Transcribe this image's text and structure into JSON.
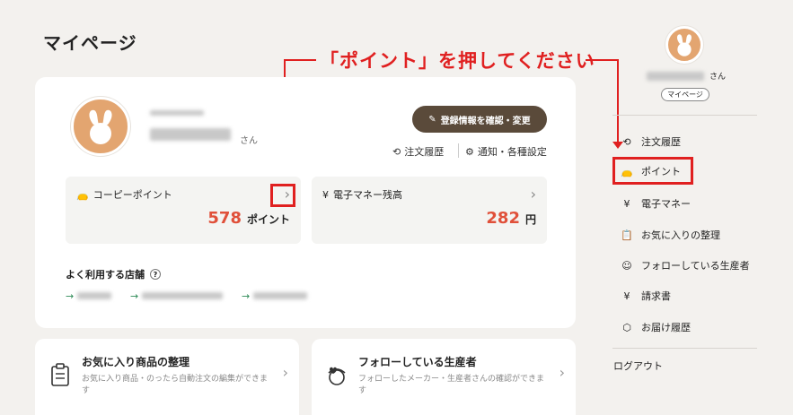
{
  "page": {
    "title": "マイページ"
  },
  "callout": {
    "text": "「ポイント」を押してください"
  },
  "profile": {
    "honorific": "さん",
    "edit_button": "登録情報を確認・変更",
    "order_history": "注文履歴",
    "notification_settings": "通知・各種設定"
  },
  "points": {
    "copy_label": "コーピーポイント",
    "copy_value": "578",
    "copy_unit": "ポイント",
    "emoney_label": "電子マネー残高",
    "emoney_value": "282",
    "emoney_unit": "円"
  },
  "favorites": {
    "title": "よく利用する店舗"
  },
  "cards": [
    {
      "title": "お気に入り商品の整理",
      "sub": "お気に入り商品・のったら自動注文の編集ができます"
    },
    {
      "title": "フォローしている生産者",
      "sub": "フォローしたメーカー・生産者さんの確認ができます"
    }
  ],
  "sidebar": {
    "honorific": "さん",
    "mypage_label": "マイページ",
    "items": [
      {
        "label": "注文履歴",
        "icon": "history-icon"
      },
      {
        "label": "ポイント",
        "icon": "point-bag-icon"
      },
      {
        "label": "電子マネー",
        "icon": "yen-coin-icon"
      },
      {
        "label": "お気に入りの整理",
        "icon": "clipboard-icon"
      },
      {
        "label": "フォローしている生産者",
        "icon": "producer-icon"
      },
      {
        "label": "請求書",
        "icon": "invoice-icon"
      },
      {
        "label": "お届け履歴",
        "icon": "delivery-box-icon"
      }
    ],
    "logout": "ログアウト"
  },
  "colors": {
    "accent_red": "#e02020",
    "point_red": "#e0503a",
    "button_brown": "#5a4a3a",
    "avatar_orange": "#e3a570"
  }
}
